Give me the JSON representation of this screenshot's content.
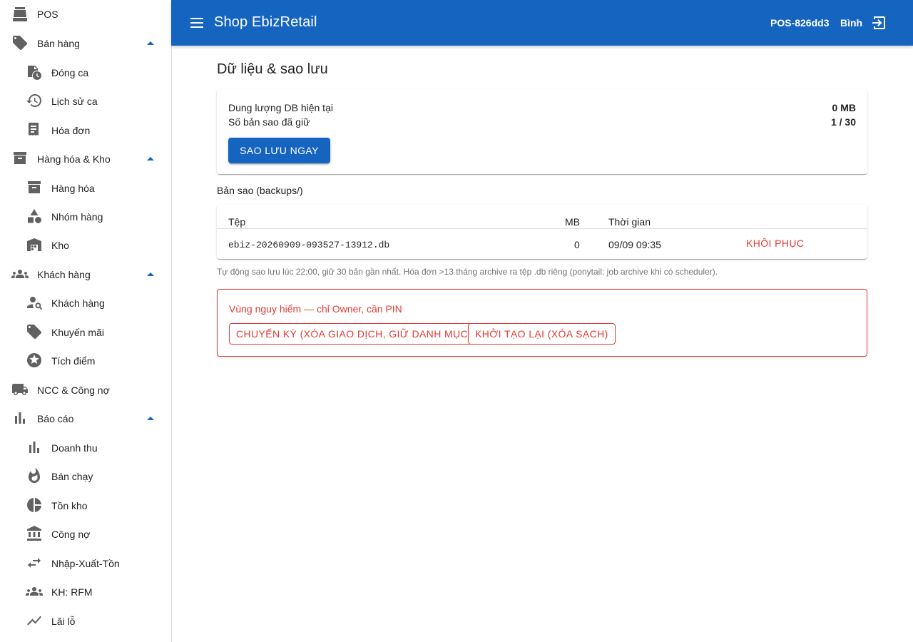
{
  "sidebar": {
    "pos": "POS",
    "sales": {
      "label": "Bán hàng",
      "items": [
        "Đóng ca",
        "Lịch sử ca",
        "Hóa đơn"
      ]
    },
    "inventory": {
      "label": "Hàng hóa & Kho",
      "items": [
        "Hàng hóa",
        "Nhóm hàng",
        "Kho"
      ]
    },
    "customers": {
      "label": "Khách hàng",
      "items": [
        "Khách hàng",
        "Khuyến mãi",
        "Tích điểm"
      ]
    },
    "suppliers": "NCC & Công nợ",
    "reports": {
      "label": "Báo cáo",
      "items": [
        "Doanh thu",
        "Bán chạy",
        "Tồn kho",
        "Công nợ",
        "Nhập-Xuất-Tồn",
        "KH: RFM",
        "Lãi lỗ"
      ]
    }
  },
  "appbar": {
    "title": "Shop EbizRetail",
    "pos_id": "POS-826dd3",
    "user": "Bình"
  },
  "page": {
    "title": "Dữ liệu & sao lưu",
    "db_size_label": "Dung lượng DB hiện tại",
    "db_size_value": "0 MB",
    "backup_count_label": "Số bản sao đã giữ",
    "backup_count_value": "1 / 30",
    "backup_button": "SAO LƯU NGAY",
    "backups_title": "Bản sao (backups/)",
    "table": {
      "headers": [
        "Tệp",
        "MB",
        "Thời gian"
      ],
      "rows": [
        {
          "file": "ebiz-20260909-093527-13912.db",
          "mb": "0",
          "time": "09/09 09:35",
          "action": "KHÔI PHỤC"
        }
      ]
    },
    "note": "Tự động sao lưu lúc 22:00, giữ 30 bản gần nhất. Hóa đơn >13 tháng archive ra tệp .db riêng (ponytail: job archive khi có scheduler).",
    "danger": {
      "title": "Vùng nguy hiểm — chỉ Owner, cần PIN",
      "rollover_button": "CHUYỂN KỲ (XÓA GIAO DỊCH, GIỮ DANH MỤC)",
      "reset_button": "KHỞI TẠO LẠI (XÓA SẠCH)"
    }
  },
  "colors": {
    "primary": "#1565c0",
    "danger": "#e53935",
    "icon": "#616161"
  }
}
